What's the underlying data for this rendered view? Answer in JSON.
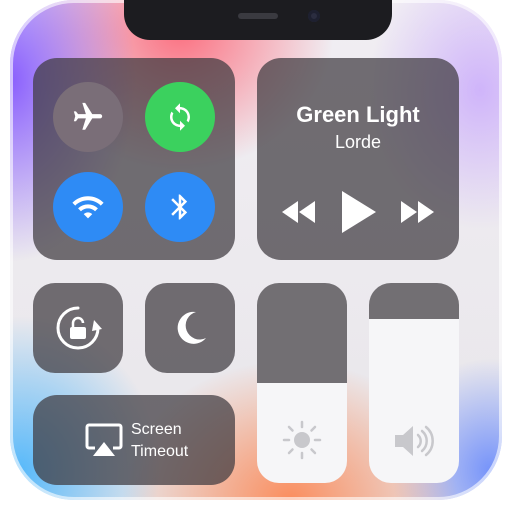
{
  "media": {
    "title": "Green Light",
    "artist": "Lorde"
  },
  "screen_timeout": {
    "label_line1": "Screen",
    "label_line2": "Timeout"
  },
  "sliders": {
    "brightness_level": 0.5,
    "volume_level": 0.82
  },
  "colors": {
    "airplane_bg": "#7a6e78",
    "sync_bg": "#3bd15e",
    "wifi_bg": "#2e8bf5",
    "bluetooth_bg": "#2e8bf5",
    "panel_bg": "#3e3a40"
  },
  "icons": [
    "airplane-icon",
    "sync-icon",
    "wifi-icon",
    "bluetooth-icon",
    "rewind-icon",
    "play-icon",
    "fast-forward-icon",
    "rotation-lock-icon",
    "moon-icon",
    "airplay-icon",
    "sun-icon",
    "speaker-icon"
  ]
}
